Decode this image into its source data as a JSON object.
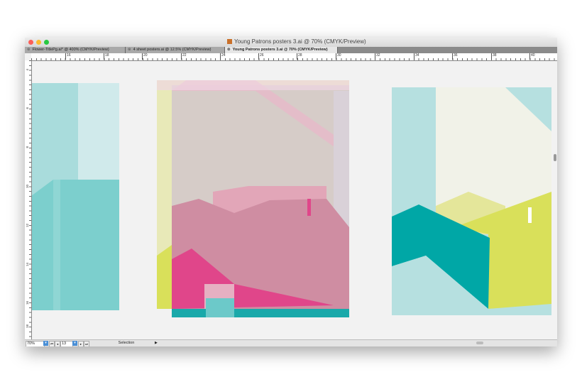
{
  "window": {
    "title": "Young Patrons posters 3.ai @ 70% (CMYK/Preview)"
  },
  "tabs": [
    {
      "label": "Flower-TitlePg.ai* @ 400% (CMYK/Preview)",
      "active": false
    },
    {
      "label": "4 sheet posters.ai @ 12.5% (CMYK/Preview)",
      "active": false
    },
    {
      "label": "Young Patrons posters 3.ai @ 70% (CMYK/Preview)",
      "active": true
    }
  ],
  "ruler": {
    "h_labels": [
      "16",
      "18",
      "20",
      "22",
      "24",
      "26",
      "28",
      "30",
      "32",
      "34",
      "36",
      "38",
      "40"
    ],
    "v_labels": [
      "4",
      "6",
      "8",
      "10",
      "12",
      "14",
      "16",
      "18"
    ]
  },
  "status": {
    "zoom": "70%",
    "artboard": "13",
    "tool": "Selection"
  },
  "colors": {
    "teal": "#00a7a6",
    "light_teal": "#b6e0e0",
    "magenta": "#e0468a",
    "yellow": "#d9e05a",
    "canvas": "#f2f2f2"
  }
}
